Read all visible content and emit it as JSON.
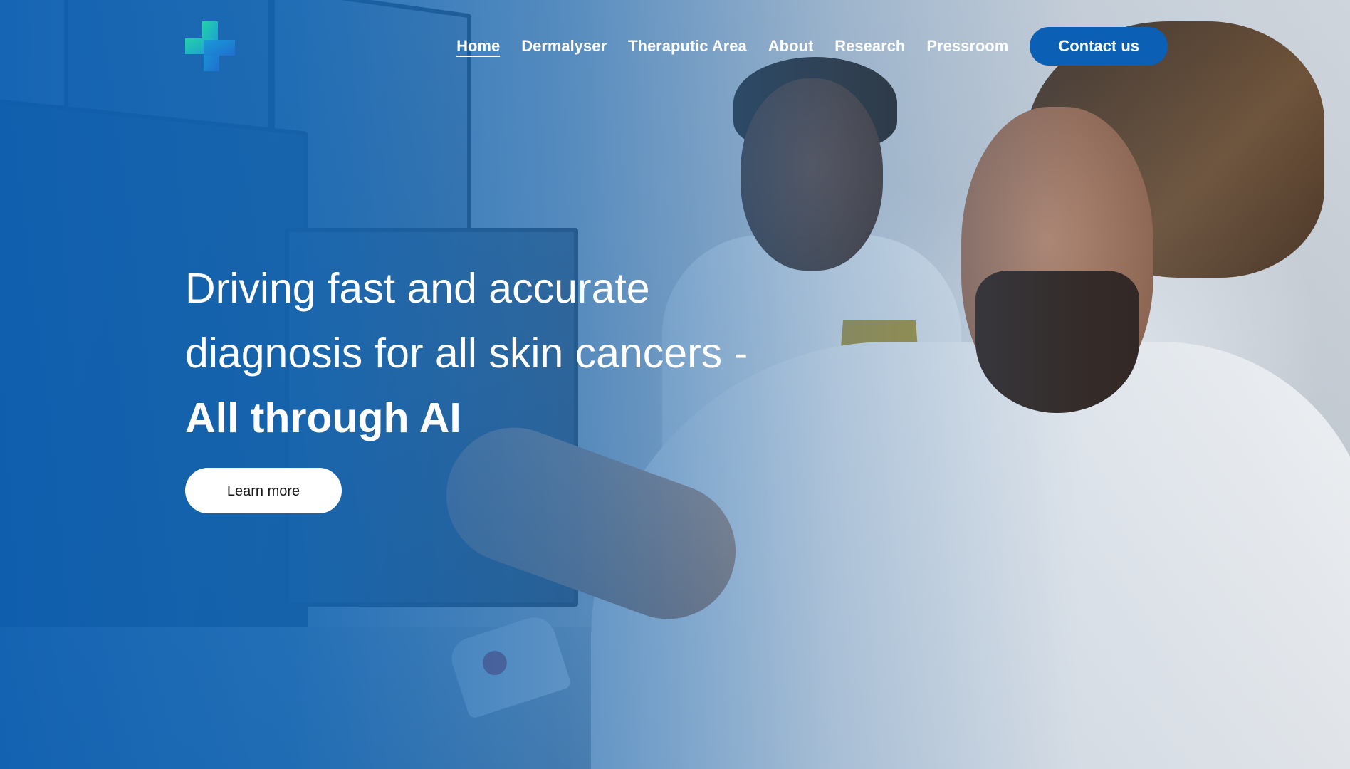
{
  "header": {
    "logo_icon": "medical-cross-logo-icon",
    "nav": [
      {
        "label": "Home",
        "active": true
      },
      {
        "label": "Dermalyser",
        "active": false
      },
      {
        "label": "Theraputic Area",
        "active": false
      },
      {
        "label": "About",
        "active": false
      },
      {
        "label": "Research",
        "active": false
      },
      {
        "label": "Pressroom",
        "active": false
      }
    ],
    "contact_label": "Contact us"
  },
  "hero": {
    "line1": "Driving fast and accurate",
    "line2": "diagnosis for all skin cancers -",
    "line3": "All through AI",
    "cta_label": "Learn more"
  },
  "colors": {
    "brand_blue": "#0b5fb4",
    "overlay_blue": "#0e60b2",
    "logo_green": "#1fc4a0",
    "logo_blue": "#1f78d1",
    "text_white": "#ffffff"
  }
}
